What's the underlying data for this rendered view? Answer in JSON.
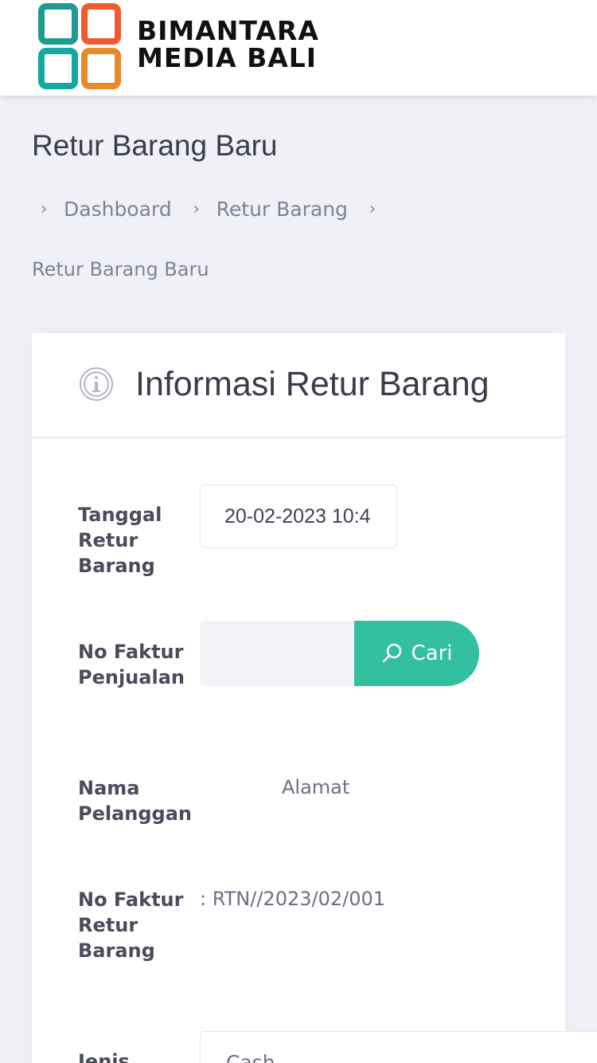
{
  "brand": {
    "line1": "BIMANTARA",
    "line2": "MEDIA BALI"
  },
  "page": {
    "title": "Retur Barang Baru"
  },
  "breadcrumb": {
    "items": [
      "Dashboard",
      "Retur Barang"
    ],
    "current": "Retur Barang Baru"
  },
  "card": {
    "title": "Informasi Retur Barang",
    "fields": {
      "tanggal": {
        "label": "Tanggal Retur Barang",
        "value": "20-02-2023 10:4"
      },
      "faktur_penjualan": {
        "label": "No Faktur Penjualan",
        "value": "",
        "button": "Cari"
      },
      "nama_pelanggan": {
        "label": "Nama Pelanggan",
        "alamat_label": "Alamat"
      },
      "faktur_retur": {
        "label": "No Faktur Retur Barang",
        "value": ": RTN//2023/02/001"
      },
      "jenis": {
        "label": "Jenis",
        "value": "Cash"
      }
    }
  },
  "colors": {
    "accent": "#33bfa0",
    "background": "#f0f1f7"
  },
  "icons": {
    "info": "info-circle-icon",
    "search": "search-icon",
    "chevron": "chevron-right-icon"
  }
}
